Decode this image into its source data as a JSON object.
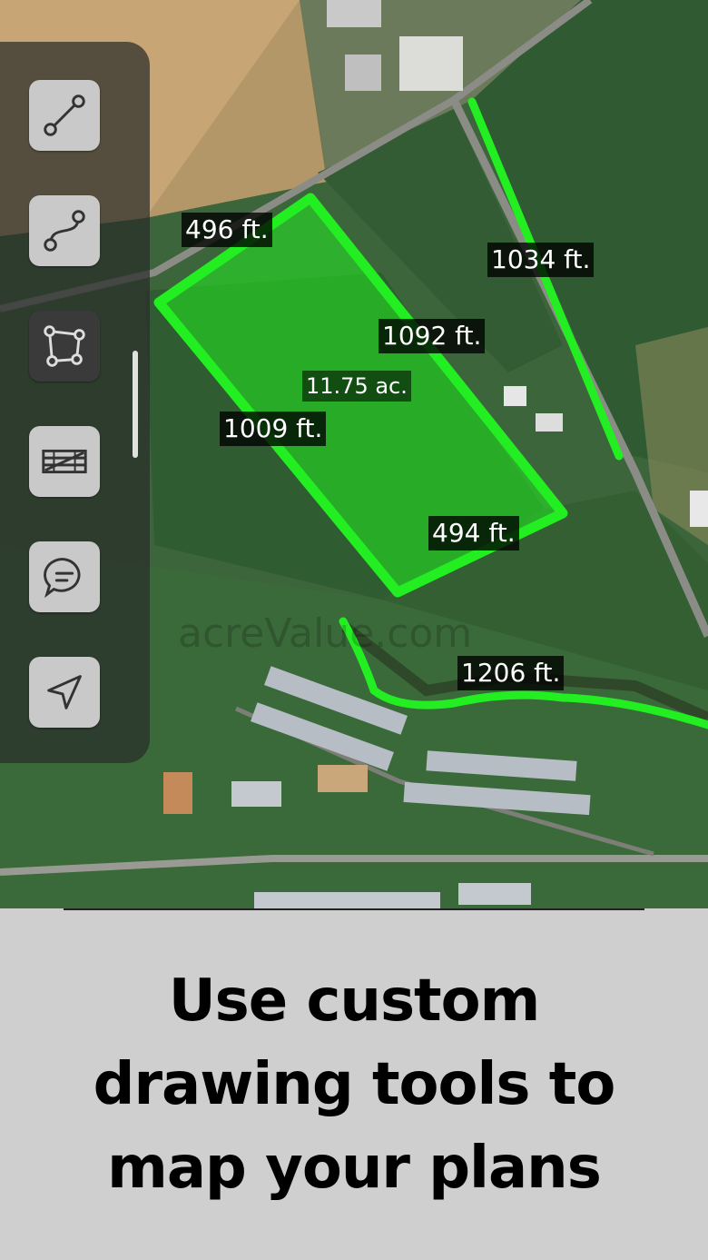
{
  "map": {
    "measurements": [
      {
        "id": "m1",
        "label": "496 ft."
      },
      {
        "id": "m2",
        "label": "1034 ft."
      },
      {
        "id": "m3",
        "label": "1092 ft."
      },
      {
        "id": "m4",
        "label": "11.75 ac."
      },
      {
        "id": "m5",
        "label": "1009 ft."
      },
      {
        "id": "m6",
        "label": "494 ft."
      },
      {
        "id": "m7",
        "label": "1206 ft."
      }
    ],
    "watermark": "acreValue.com",
    "overlay_color": "#22ee22"
  },
  "toolbar": {
    "tools": [
      {
        "name": "line-tool",
        "icon": "straight-line-icon",
        "active": false
      },
      {
        "name": "curve-tool",
        "icon": "curve-line-icon",
        "active": false
      },
      {
        "name": "polygon-tool",
        "icon": "polygon-icon",
        "active": true
      },
      {
        "name": "fence-tool",
        "icon": "fence-icon",
        "active": false
      },
      {
        "name": "comment-tool",
        "icon": "speech-bubble-icon",
        "active": false
      },
      {
        "name": "location-tool",
        "icon": "location-arrow-icon",
        "active": false
      }
    ]
  },
  "caption": {
    "line1": "Use custom",
    "line2": "drawing tools to",
    "line3": "map your plans"
  }
}
